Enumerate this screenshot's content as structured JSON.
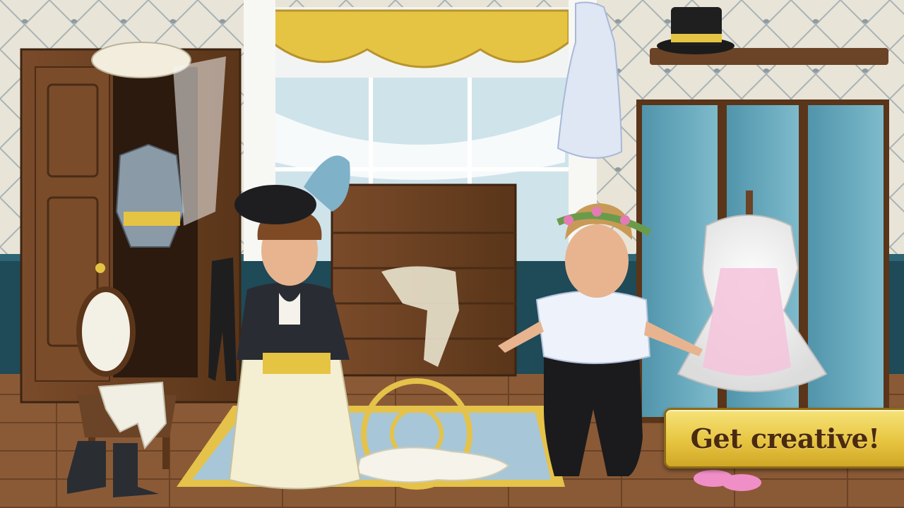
{
  "cta": {
    "label": "Get creative!"
  },
  "palette": {
    "wallpaper": "#e6e2d6",
    "wainscot": "#1f4a57",
    "floor": "#8a5a36",
    "wood": "#6b4326",
    "gold": "#e6c443",
    "screen_blue": "#6ea9bd",
    "rug_blue": "#a7c6d8",
    "rug_border": "#e5c24a"
  },
  "scene": {
    "name": "dressing-room",
    "objects": [
      "wardrobe",
      "military-jacket",
      "veiled-hat",
      "window",
      "gold-curtain",
      "chest",
      "top-hat",
      "shelf",
      "folding-screen",
      "chair",
      "boots",
      "rug",
      "man-character",
      "woman-character",
      "pink-dress-mannequin",
      "pink-shoes",
      "white-dress",
      "white-stockings",
      "gloves"
    ]
  }
}
